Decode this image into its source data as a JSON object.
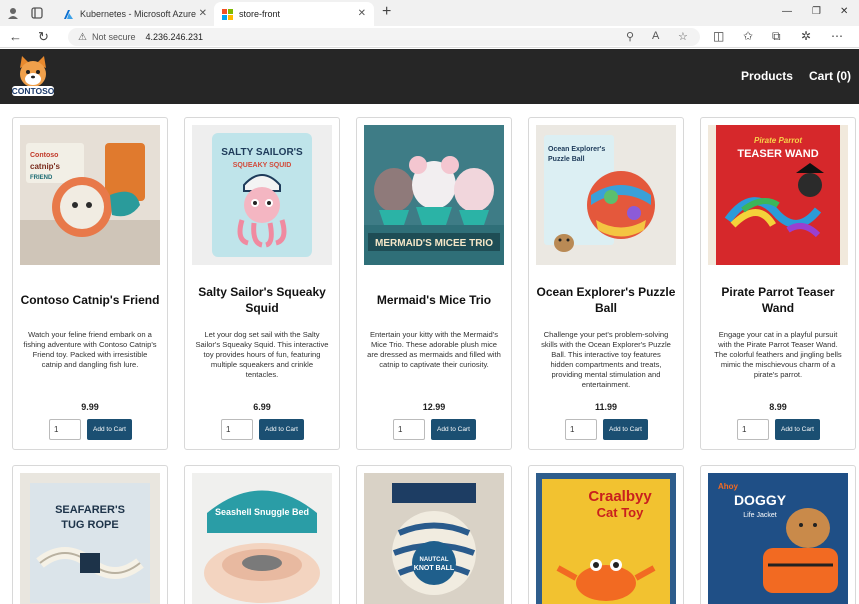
{
  "browser": {
    "tabs": [
      {
        "title": "Kubernetes - Microsoft Azure",
        "active": false
      },
      {
        "title": "store-front",
        "active": true
      }
    ],
    "address": {
      "security": "Not secure",
      "url": "4.236.246.231"
    }
  },
  "site": {
    "logo_text": "CONTOSO",
    "nav": {
      "products": "Products",
      "cart": "Cart (0)"
    }
  },
  "products": [
    {
      "name": "Contoso Catnip's Friend",
      "description": "Watch your feline friend embark on a fishing adventure with Contoso Catnip's Friend toy. Packed with irresistible catnip and dangling fish lure.",
      "price": "9.99",
      "qty": "1",
      "button": "Add to Cart",
      "image_label": "Contoso catnip's FRIEND"
    },
    {
      "name": "Salty Sailor's Squeaky Squid",
      "description": "Let your dog set sail with the Salty Sailor's Squeaky Squid. This interactive toy provides hours of fun, featuring multiple squeakers and crinkle tentacles.",
      "price": "6.99",
      "qty": "1",
      "button": "Add to Cart",
      "image_label": "SALTY SAILOR'S SQUEAKY SQUID"
    },
    {
      "name": "Mermaid's Mice Trio",
      "description": "Entertain your kitty with the Mermaid's Mice Trio. These adorable plush mice are dressed as mermaids and filled with catnip to captivate their curiosity.",
      "price": "12.99",
      "qty": "1",
      "button": "Add to Cart",
      "image_label": "MERMAID'S MICEE TRIO"
    },
    {
      "name": "Ocean Explorer's Puzzle Ball",
      "description": "Challenge your pet's problem-solving skills with the Ocean Explorer's Puzzle Ball. This interactive toy features hidden compartments and treats, providing mental stimulation and entertainment.",
      "price": "11.99",
      "qty": "1",
      "button": "Add to Cart",
      "image_label": "Ocean Explorer's Puzzle Ball"
    },
    {
      "name": "Pirate Parrot Teaser Wand",
      "description": "Engage your cat in a playful pursuit with the Pirate Parrot Teaser Wand. The colorful feathers and jingling bells mimic the mischievous charm of a pirate's parrot.",
      "price": "8.99",
      "qty": "1",
      "button": "Add to Cart",
      "image_label": "Pirate Parrot TEASER WAND"
    },
    {
      "image_label": "SEAFARER'S TUG ROPE"
    },
    {
      "image_label": "Seashell Snuggle Bed"
    },
    {
      "image_label": "NAUTCAL KNOT BALL"
    },
    {
      "image_label": "Craalbyy Cat Toy"
    },
    {
      "image_label": "Ahoy DOGGY Life Jacket"
    }
  ],
  "colors": {
    "header_bg": "#262626",
    "button_bg": "#1b4f72"
  }
}
